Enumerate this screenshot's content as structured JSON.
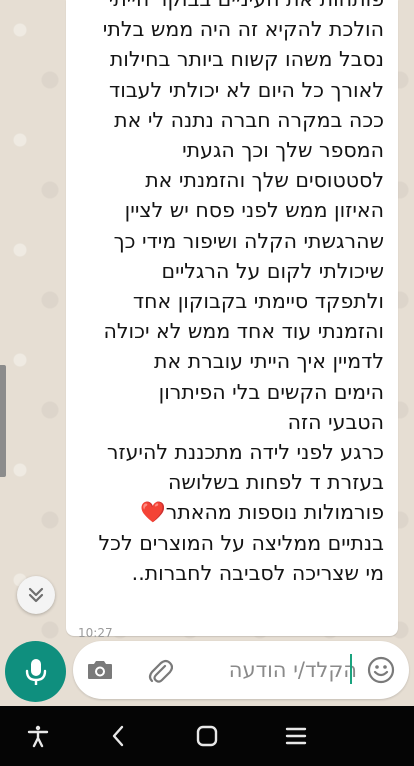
{
  "message": {
    "lines": [
      "פותחות את העיניים בבוקר הייתי",
      "הולכת להקיא זה היה ממש בלתי",
      "נסבל משהו קשוח ביותר בחילות",
      "לאורך כל היום לא יכולתי לעבוד",
      "ככה במקרה חברה נתנה לי את",
      "המספר שלך וכך הגעתי",
      "לסטטוסים שלך והזמנתי את",
      "האיזון ממש לפני פסח יש לציין",
      "שהרגשתי הקלה ושיפור מידי כך",
      "שיכולתי לקום על הרגליים",
      "ולתפקד סיימתי בקבוקון אחד",
      "והזמנתי עוד אחד ממש לא יכולה",
      "לדמיין איך הייתי עוברת את",
      "הימים הקשים בלי הפיתרון",
      "הטבעי הזה",
      "כרגע לפני לידה מתכננת להיעזר",
      "בעזרת ד לפחות בשלושה",
      "פורמולות נוספות מהאתר❤️",
      "בנתיים ממליצה על המוצרים לכל",
      "מי שצריכה לסביבה לחברות.."
    ],
    "time": "10:27"
  },
  "composer": {
    "placeholder": "הקלד/י הודעה"
  },
  "icons": {
    "scroll_down": "chevrons-down-icon",
    "mic": "microphone-icon",
    "emoji": "emoji-icon",
    "attach": "paperclip-icon",
    "camera": "camera-icon",
    "accessibility": "accessibility-icon",
    "back": "back-icon",
    "home": "home-icon",
    "recents": "recents-icon"
  },
  "colors": {
    "accent": "#0f8f7e",
    "chat_background": "#e6ded3",
    "bubble": "#ffffff",
    "navbar": "#050505"
  }
}
